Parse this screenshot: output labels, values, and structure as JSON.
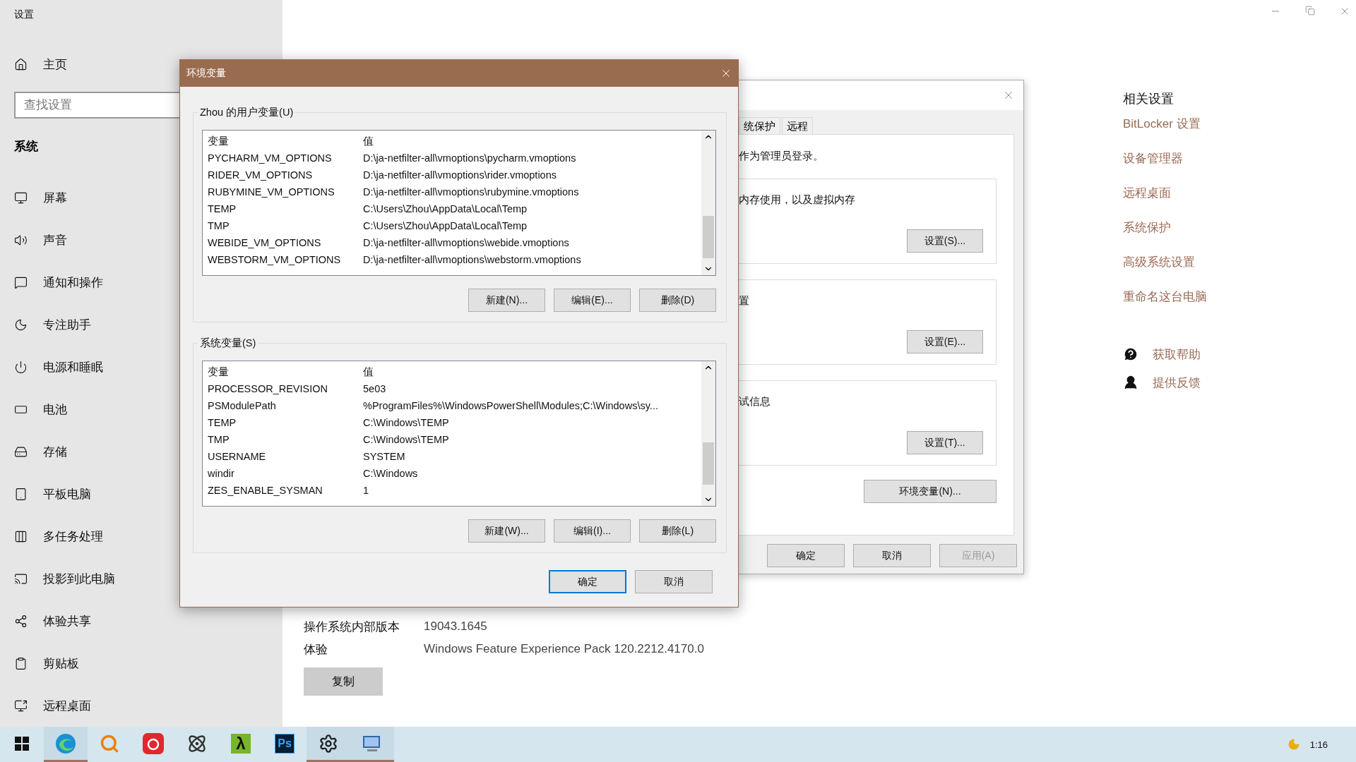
{
  "settings_window": {
    "title": "设置",
    "home": "主页",
    "search": {
      "placeholder": "查找设置"
    },
    "section": "系统",
    "sidebar": {
      "items": [
        {
          "label": "屏幕"
        },
        {
          "label": "声音"
        },
        {
          "label": "通知和操作"
        },
        {
          "label": "专注助手"
        },
        {
          "label": "电源和睡眠"
        },
        {
          "label": "电池"
        },
        {
          "label": "存储"
        },
        {
          "label": "平板电脑"
        },
        {
          "label": "多任务处理"
        },
        {
          "label": "投影到此电脑"
        },
        {
          "label": "体验共享"
        },
        {
          "label": "剪贴板"
        },
        {
          "label": "远程桌面"
        }
      ]
    },
    "page": {
      "specs": [
        {
          "label": "操作系统内部版本",
          "value": "19043.1645"
        },
        {
          "label": "体验",
          "value": "Windows Feature Experience Pack 120.2212.4170.0"
        }
      ],
      "copy_button": "复制"
    },
    "related": {
      "title": "相关设置",
      "links": [
        "BitLocker 设置",
        "设备管理器",
        "远程桌面",
        "系统保护",
        "高级系统设置",
        "重命名这台电脑"
      ],
      "help": [
        {
          "kind": "help",
          "label": "获取帮助"
        },
        {
          "kind": "feedback",
          "label": "提供反馈"
        }
      ]
    }
  },
  "sysprops_dialog": {
    "tabs": [
      {
        "label": "统保护",
        "selected": false
      },
      {
        "label": "远程",
        "selected": false
      }
    ],
    "note": "作为管理员登录。",
    "groups": [
      {
        "text": "内存使用，以及虚拟内存",
        "button": "设置(S)..."
      },
      {
        "text": "置",
        "button": "设置(E)..."
      },
      {
        "text": "试信息",
        "button": "设置(T)..."
      }
    ],
    "env_button": "环境变量(N)...",
    "buttons": [
      {
        "label": "确定",
        "disabled": false
      },
      {
        "label": "取消",
        "disabled": false
      },
      {
        "label": "应用(A)",
        "disabled": true
      }
    ]
  },
  "env_dialog": {
    "title": "环境变量",
    "sections": [
      {
        "label": "Zhou 的用户变量(U)",
        "columns": [
          "变量",
          "值"
        ],
        "rows": [
          [
            "PYCHARM_VM_OPTIONS",
            "D:\\ja-netfilter-all\\vmoptions\\pycharm.vmoptions"
          ],
          [
            "RIDER_VM_OPTIONS",
            "D:\\ja-netfilter-all\\vmoptions\\rider.vmoptions"
          ],
          [
            "RUBYMINE_VM_OPTIONS",
            "D:\\ja-netfilter-all\\vmoptions\\rubymine.vmoptions"
          ],
          [
            "TEMP",
            "C:\\Users\\Zhou\\AppData\\Local\\Temp"
          ],
          [
            "TMP",
            "C:\\Users\\Zhou\\AppData\\Local\\Temp"
          ],
          [
            "WEBIDE_VM_OPTIONS",
            "D:\\ja-netfilter-all\\vmoptions\\webide.vmoptions"
          ],
          [
            "WEBSTORM_VM_OPTIONS",
            "D:\\ja-netfilter-all\\vmoptions\\webstorm.vmoptions"
          ]
        ],
        "buttons": [
          "新建(N)...",
          "编辑(E)...",
          "删除(D)"
        ]
      },
      {
        "label": "系统变量(S)",
        "columns": [
          "变量",
          "值"
        ],
        "rows": [
          [
            "PROCESSOR_REVISION",
            "5e03"
          ],
          [
            "PSModulePath",
            "%ProgramFiles%\\WindowsPowerShell\\Modules;C:\\Windows\\sy..."
          ],
          [
            "TEMP",
            "C:\\Windows\\TEMP"
          ],
          [
            "TMP",
            "C:\\Windows\\TEMP"
          ],
          [
            "USERNAME",
            "SYSTEM"
          ],
          [
            "windir",
            "C:\\Windows"
          ],
          [
            "ZES_ENABLE_SYSMAN",
            "1"
          ]
        ],
        "buttons": [
          "新建(W)...",
          "编辑(I)...",
          "删除(L)"
        ]
      }
    ],
    "buttons": [
      {
        "label": "确定",
        "default": true
      },
      {
        "label": "取消",
        "default": false
      }
    ]
  },
  "taskbar": {
    "apps": [
      {
        "kind": "windows",
        "open": false
      },
      {
        "kind": "edge",
        "open": true
      },
      {
        "kind": "search",
        "open": false
      },
      {
        "kind": "music",
        "open": false
      },
      {
        "kind": "atom",
        "open": false
      },
      {
        "kind": "lambda",
        "label": "λ",
        "open": false
      },
      {
        "kind": "ps",
        "label": "Ps",
        "open": false
      },
      {
        "kind": "gear",
        "open": true
      },
      {
        "kind": "system",
        "open": true
      }
    ],
    "clock": "1:16"
  }
}
